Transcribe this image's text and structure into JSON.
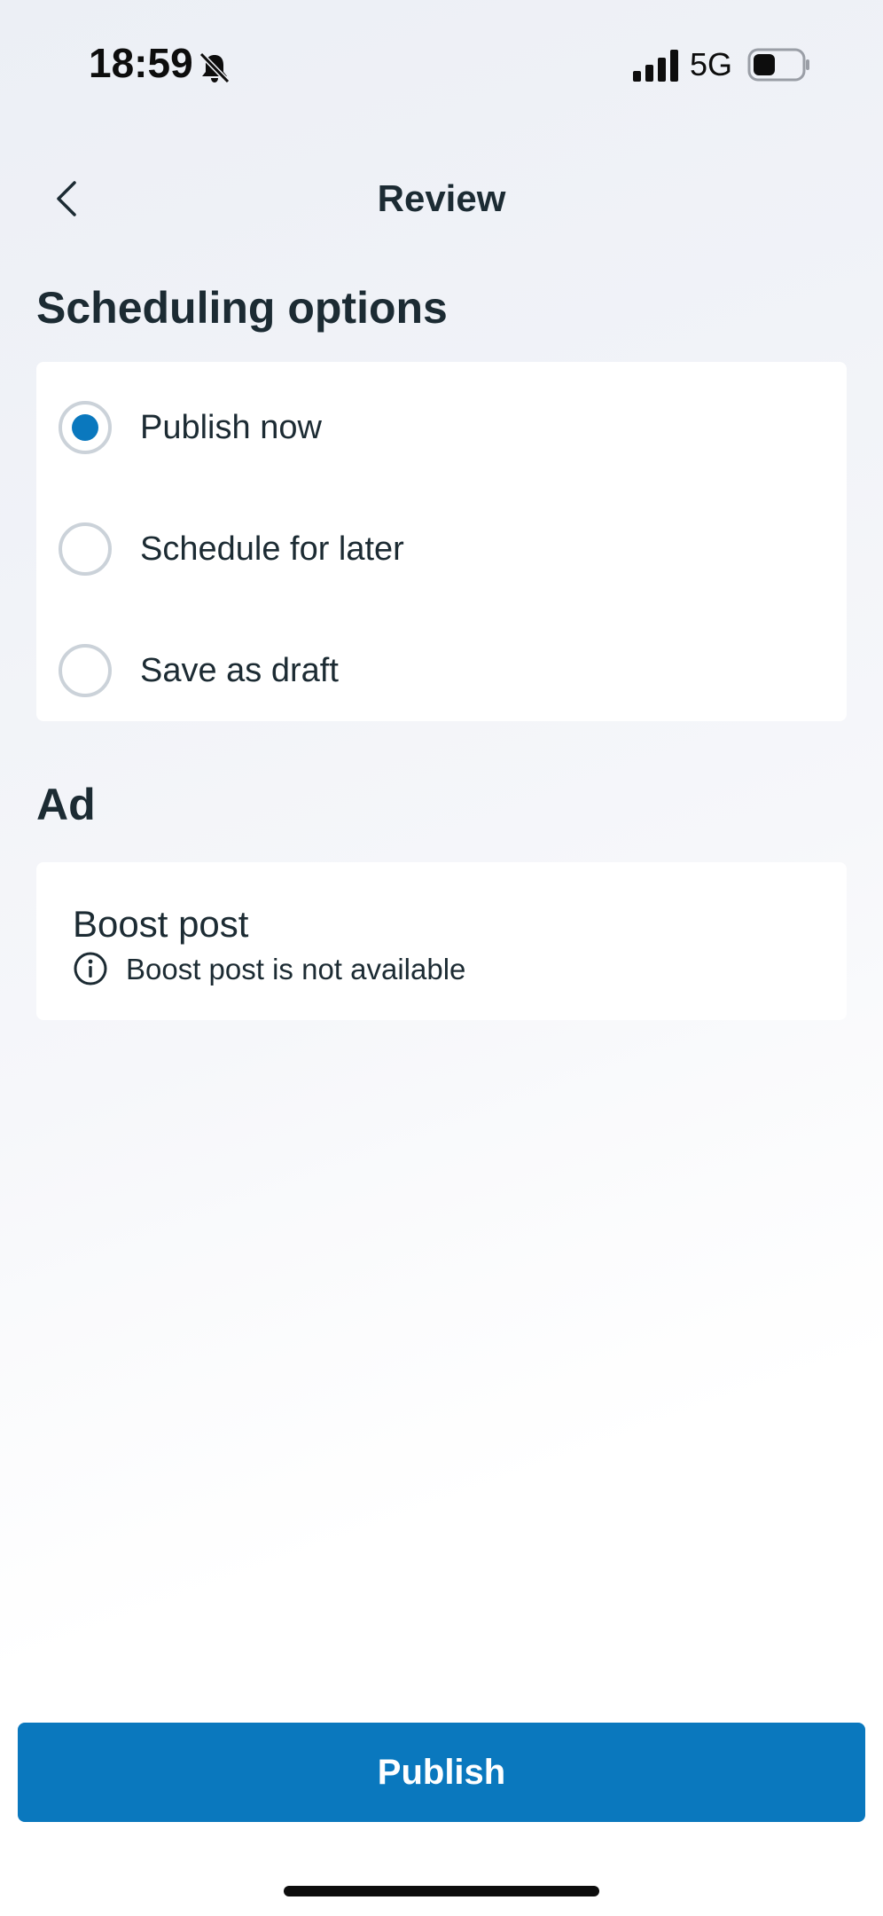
{
  "status_bar": {
    "time": "18:59",
    "network": "5G",
    "icons": [
      "bell-off-icon",
      "signal-icon",
      "battery-icon"
    ]
  },
  "header": {
    "title": "Review",
    "back_icon": "chevron-left-icon"
  },
  "scheduling": {
    "heading": "Scheduling options",
    "options": [
      {
        "label": "Publish now",
        "selected": true
      },
      {
        "label": "Schedule for later",
        "selected": false
      },
      {
        "label": "Save as draft",
        "selected": false
      }
    ]
  },
  "ad": {
    "heading": "Ad",
    "boost_title": "Boost post",
    "boost_info_icon": "info-icon",
    "boost_message": "Boost post is not available"
  },
  "footer": {
    "publish_label": "Publish"
  },
  "colors": {
    "accent": "#0a78be",
    "text": "#1c2b33",
    "radio_border": "#cbd2d9"
  }
}
